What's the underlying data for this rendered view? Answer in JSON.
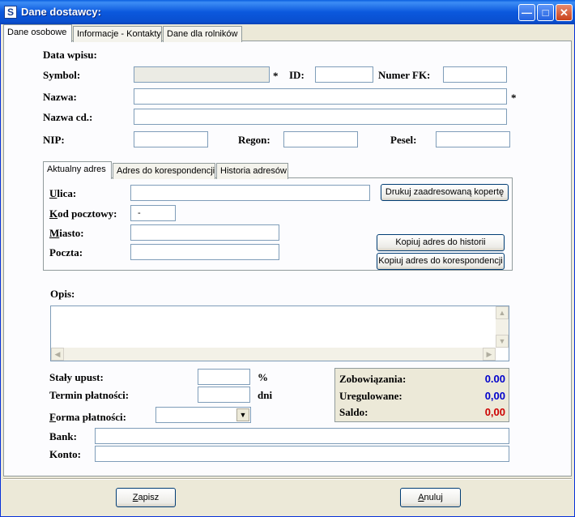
{
  "window": {
    "title": "Dane dostawcy:"
  },
  "tabs": [
    "Dane osobowe",
    "Informacje - Kontakty",
    "Dane dla rolników"
  ],
  "form": {
    "data_wpisu_label": "Data wpisu:",
    "symbol_label": "Symbol:",
    "required_mark": "*",
    "id_label": "ID:",
    "numer_fk_label": "Numer FK:",
    "nazwa_label": "Nazwa:",
    "nazwa_cd_label": "Nazwa cd.:",
    "nip_label": "NIP:",
    "regon_label": "Regon:",
    "pesel_label": "Pesel:"
  },
  "address": {
    "tabs": [
      "Aktualny adres",
      "Adres do korespondencji",
      "Historia adresów"
    ],
    "ulica_label_u": "U",
    "ulica_label_rest": "lica:",
    "kod_label_u": "K",
    "kod_label_rest": "od pocztowy:",
    "kod_value": "-",
    "miasto_label_u": "M",
    "miasto_label_rest": "iasto:",
    "poczta_label": "Poczta:",
    "print_button": "Drukuj zaadresowaną kopertę",
    "copy_history_button": "Kopiuj adres do historii",
    "copy_corr_button": "Kopiuj adres do korespondencji"
  },
  "opis_label": "Opis:",
  "payment": {
    "upust_label": "Stały upust:",
    "upust_unit": "%",
    "termin_label": "Termin płatności:",
    "termin_unit": "dni",
    "forma_label_u": "F",
    "forma_label_rest": "orma płatności:",
    "bank_label": "Bank:",
    "konto_label": "Konto:"
  },
  "summary": {
    "zobowiazania_label": "Zobowiązania:",
    "zobowiazania_value": "0.00",
    "uregulowane_label": "Uregulowane:",
    "uregulowane_value": "0,00",
    "saldo_label": "Saldo:",
    "saldo_value": "0,00"
  },
  "buttons": {
    "save_u": "Z",
    "save_rest": "apisz",
    "cancel_u": "A",
    "cancel_rest": "nuluj"
  },
  "colors": {
    "title_bar": "#0a5fe0",
    "zobowiazania": "#0000cc",
    "uregulowane": "#0000cc",
    "saldo": "#cc0000"
  }
}
